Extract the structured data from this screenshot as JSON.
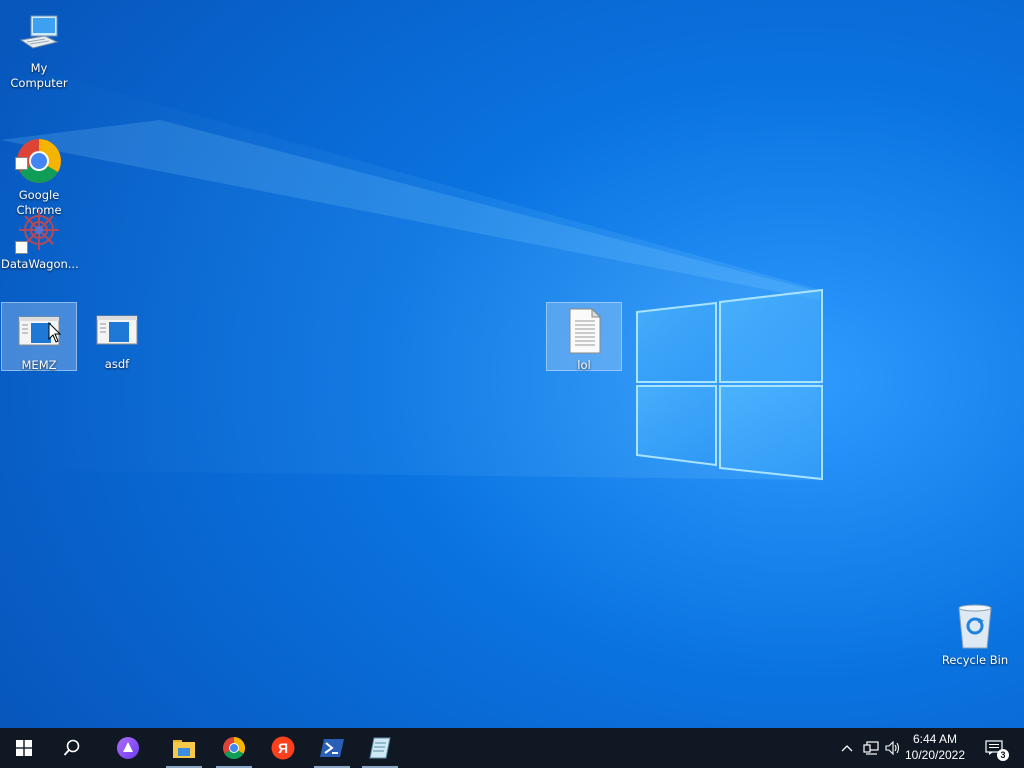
{
  "desktop": {
    "icons": [
      {
        "label": "My Computer"
      },
      {
        "label": "Google\nChrome"
      },
      {
        "label": "DataWagon..."
      },
      {
        "label": "MEMZ"
      },
      {
        "label": "asdf"
      },
      {
        "label": "lol"
      },
      {
        "label": "Recycle Bin"
      }
    ]
  },
  "taskbar": {
    "start": "start-icon",
    "search": "search-icon",
    "pinned": [
      "alice-assistant-icon",
      "file-explorer-icon",
      "chrome-icon",
      "yandex-browser-icon",
      "powershell-icon",
      "notepad-icon"
    ],
    "clock": {
      "time": "6:44 AM",
      "date": "10/20/2022"
    },
    "notifications_count": "3"
  },
  "colors": {
    "wallpaper": "#0a6fd6",
    "taskbar": "#101823",
    "accent": "#3b9cff"
  }
}
